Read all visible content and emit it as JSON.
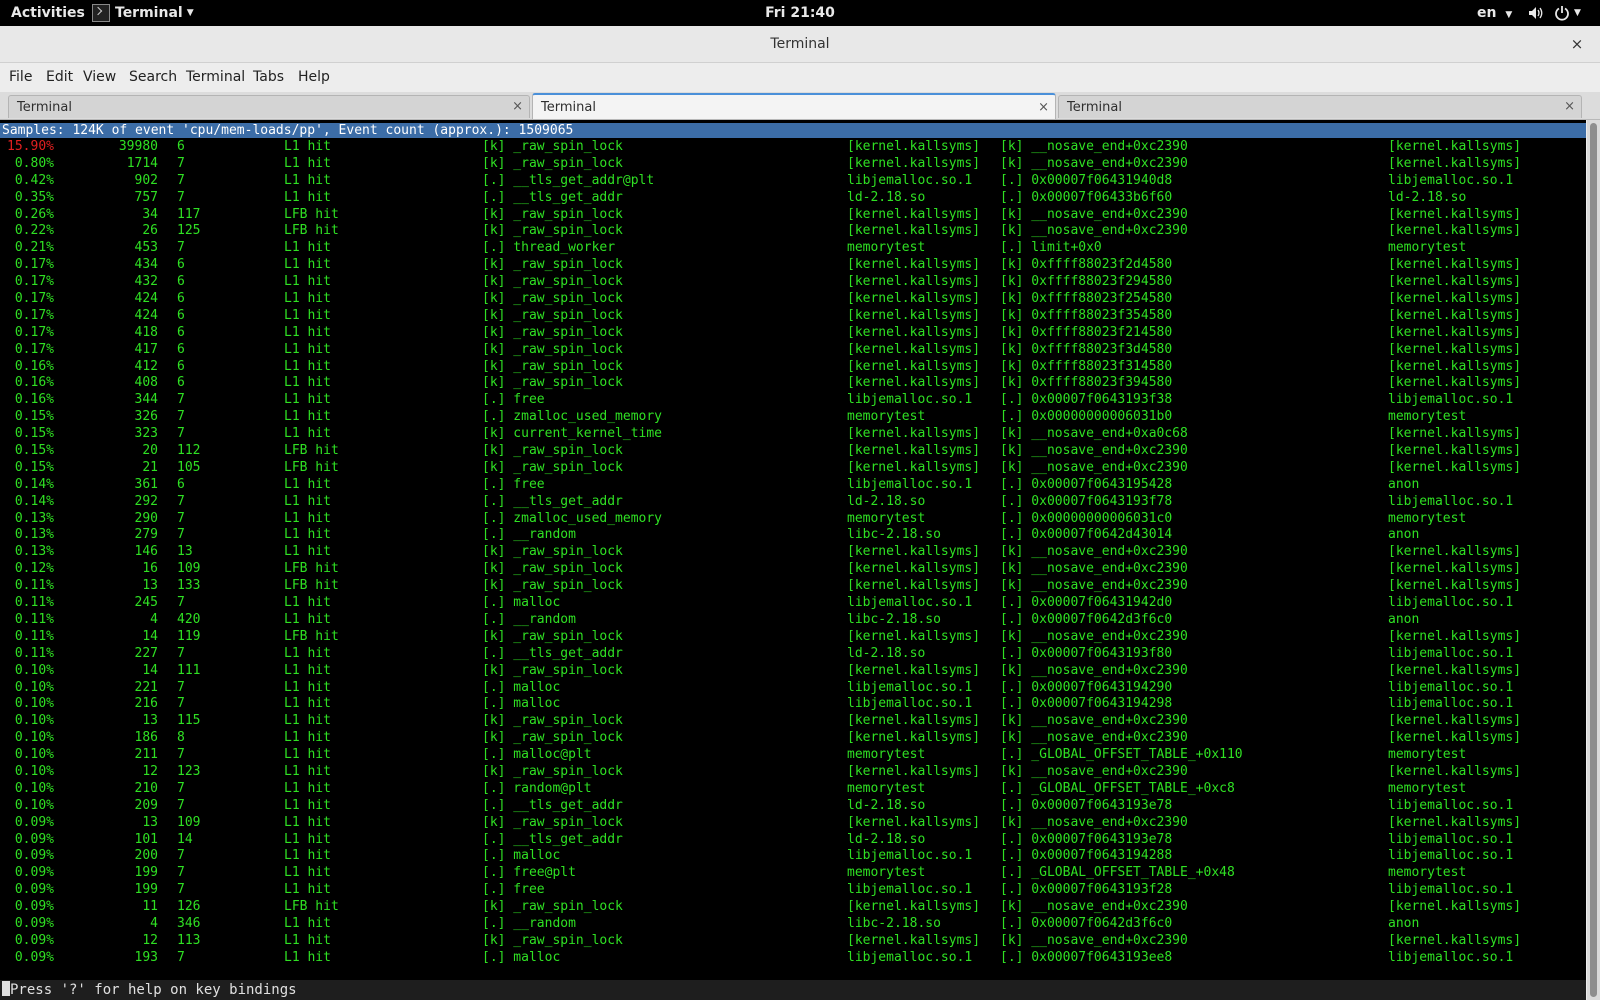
{
  "topbar": {
    "activities": "Activities",
    "app_menu": "Terminal",
    "clock": "Fri 21:40",
    "language": "en"
  },
  "window": {
    "title": "Terminal",
    "close_label": "×"
  },
  "menubar": [
    "File",
    "Edit",
    "View",
    "Search",
    "Terminal",
    "Tabs",
    "Help"
  ],
  "tabs": [
    {
      "label": "Terminal",
      "close": "×"
    },
    {
      "label": "Terminal",
      "close": "×"
    },
    {
      "label": "Terminal",
      "close": "×"
    }
  ],
  "perf": {
    "header": "Samples: 124K of event 'cpu/mem-loads/pp', Event count (approx.): 1509065",
    "rows": [
      {
        "pct": "15.90%",
        "samples": "39980",
        "weight": "6",
        "type": "L1 hit",
        "sym": "[k] _raw_spin_lock",
        "obj": "[kernel.kallsyms]",
        "daddr": "[k] __nosave_end+0xc2390",
        "dobj": "[kernel.kallsyms]"
      },
      {
        "pct": "0.80%",
        "samples": "1714",
        "weight": "7",
        "type": "L1 hit",
        "sym": "[k] _raw_spin_lock",
        "obj": "[kernel.kallsyms]",
        "daddr": "[k] __nosave_end+0xc2390",
        "dobj": "[kernel.kallsyms]"
      },
      {
        "pct": "0.42%",
        "samples": "902",
        "weight": "7",
        "type": "L1 hit",
        "sym": "[.] __tls_get_addr@plt",
        "obj": "libjemalloc.so.1",
        "daddr": "[.] 0x00007f06431940d8",
        "dobj": "libjemalloc.so.1"
      },
      {
        "pct": "0.35%",
        "samples": "757",
        "weight": "7",
        "type": "L1 hit",
        "sym": "[.] __tls_get_addr",
        "obj": "ld-2.18.so",
        "daddr": "[.] 0x00007f06433b6f60",
        "dobj": "ld-2.18.so"
      },
      {
        "pct": "0.26%",
        "samples": "34",
        "weight": "117",
        "type": "LFB hit",
        "sym": "[k] _raw_spin_lock",
        "obj": "[kernel.kallsyms]",
        "daddr": "[k] __nosave_end+0xc2390",
        "dobj": "[kernel.kallsyms]"
      },
      {
        "pct": "0.22%",
        "samples": "26",
        "weight": "125",
        "type": "LFB hit",
        "sym": "[k] _raw_spin_lock",
        "obj": "[kernel.kallsyms]",
        "daddr": "[k] __nosave_end+0xc2390",
        "dobj": "[kernel.kallsyms]"
      },
      {
        "pct": "0.21%",
        "samples": "453",
        "weight": "7",
        "type": "L1 hit",
        "sym": "[.] thread_worker",
        "obj": "memorytest",
        "daddr": "[.] limit+0x0",
        "dobj": "memorytest"
      },
      {
        "pct": "0.17%",
        "samples": "434",
        "weight": "6",
        "type": "L1 hit",
        "sym": "[k] _raw_spin_lock",
        "obj": "[kernel.kallsyms]",
        "daddr": "[k] 0xffff88023f2d4580",
        "dobj": "[kernel.kallsyms]"
      },
      {
        "pct": "0.17%",
        "samples": "432",
        "weight": "6",
        "type": "L1 hit",
        "sym": "[k] _raw_spin_lock",
        "obj": "[kernel.kallsyms]",
        "daddr": "[k] 0xffff88023f294580",
        "dobj": "[kernel.kallsyms]"
      },
      {
        "pct": "0.17%",
        "samples": "424",
        "weight": "6",
        "type": "L1 hit",
        "sym": "[k] _raw_spin_lock",
        "obj": "[kernel.kallsyms]",
        "daddr": "[k] 0xffff88023f254580",
        "dobj": "[kernel.kallsyms]"
      },
      {
        "pct": "0.17%",
        "samples": "424",
        "weight": "6",
        "type": "L1 hit",
        "sym": "[k] _raw_spin_lock",
        "obj": "[kernel.kallsyms]",
        "daddr": "[k] 0xffff88023f354580",
        "dobj": "[kernel.kallsyms]"
      },
      {
        "pct": "0.17%",
        "samples": "418",
        "weight": "6",
        "type": "L1 hit",
        "sym": "[k] _raw_spin_lock",
        "obj": "[kernel.kallsyms]",
        "daddr": "[k] 0xffff88023f214580",
        "dobj": "[kernel.kallsyms]"
      },
      {
        "pct": "0.17%",
        "samples": "417",
        "weight": "6",
        "type": "L1 hit",
        "sym": "[k] _raw_spin_lock",
        "obj": "[kernel.kallsyms]",
        "daddr": "[k] 0xffff88023f3d4580",
        "dobj": "[kernel.kallsyms]"
      },
      {
        "pct": "0.16%",
        "samples": "412",
        "weight": "6",
        "type": "L1 hit",
        "sym": "[k] _raw_spin_lock",
        "obj": "[kernel.kallsyms]",
        "daddr": "[k] 0xffff88023f314580",
        "dobj": "[kernel.kallsyms]"
      },
      {
        "pct": "0.16%",
        "samples": "408",
        "weight": "6",
        "type": "L1 hit",
        "sym": "[k] _raw_spin_lock",
        "obj": "[kernel.kallsyms]",
        "daddr": "[k] 0xffff88023f394580",
        "dobj": "[kernel.kallsyms]"
      },
      {
        "pct": "0.16%",
        "samples": "344",
        "weight": "7",
        "type": "L1 hit",
        "sym": "[.] free",
        "obj": "libjemalloc.so.1",
        "daddr": "[.] 0x00007f0643193f38",
        "dobj": "libjemalloc.so.1"
      },
      {
        "pct": "0.15%",
        "samples": "326",
        "weight": "7",
        "type": "L1 hit",
        "sym": "[.] zmalloc_used_memory",
        "obj": "memorytest",
        "daddr": "[.] 0x00000000006031b0",
        "dobj": "memorytest"
      },
      {
        "pct": "0.15%",
        "samples": "323",
        "weight": "7",
        "type": "L1 hit",
        "sym": "[k] current_kernel_time",
        "obj": "[kernel.kallsyms]",
        "daddr": "[k] __nosave_end+0xa0c68",
        "dobj": "[kernel.kallsyms]"
      },
      {
        "pct": "0.15%",
        "samples": "20",
        "weight": "112",
        "type": "LFB hit",
        "sym": "[k] _raw_spin_lock",
        "obj": "[kernel.kallsyms]",
        "daddr": "[k] __nosave_end+0xc2390",
        "dobj": "[kernel.kallsyms]"
      },
      {
        "pct": "0.15%",
        "samples": "21",
        "weight": "105",
        "type": "LFB hit",
        "sym": "[k] _raw_spin_lock",
        "obj": "[kernel.kallsyms]",
        "daddr": "[k] __nosave_end+0xc2390",
        "dobj": "[kernel.kallsyms]"
      },
      {
        "pct": "0.14%",
        "samples": "361",
        "weight": "6",
        "type": "L1 hit",
        "sym": "[.] free",
        "obj": "libjemalloc.so.1",
        "daddr": "[.] 0x00007f0643195428",
        "dobj": "anon"
      },
      {
        "pct": "0.14%",
        "samples": "292",
        "weight": "7",
        "type": "L1 hit",
        "sym": "[.] __tls_get_addr",
        "obj": "ld-2.18.so",
        "daddr": "[.] 0x00007f0643193f78",
        "dobj": "libjemalloc.so.1"
      },
      {
        "pct": "0.13%",
        "samples": "290",
        "weight": "7",
        "type": "L1 hit",
        "sym": "[.] zmalloc_used_memory",
        "obj": "memorytest",
        "daddr": "[.] 0x00000000006031c0",
        "dobj": "memorytest"
      },
      {
        "pct": "0.13%",
        "samples": "279",
        "weight": "7",
        "type": "L1 hit",
        "sym": "[.] __random",
        "obj": "libc-2.18.so",
        "daddr": "[.] 0x00007f0642d43014",
        "dobj": "anon"
      },
      {
        "pct": "0.13%",
        "samples": "146",
        "weight": "13",
        "type": "L1 hit",
        "sym": "[k] _raw_spin_lock",
        "obj": "[kernel.kallsyms]",
        "daddr": "[k] __nosave_end+0xc2390",
        "dobj": "[kernel.kallsyms]"
      },
      {
        "pct": "0.12%",
        "samples": "16",
        "weight": "109",
        "type": "LFB hit",
        "sym": "[k] _raw_spin_lock",
        "obj": "[kernel.kallsyms]",
        "daddr": "[k] __nosave_end+0xc2390",
        "dobj": "[kernel.kallsyms]"
      },
      {
        "pct": "0.11%",
        "samples": "13",
        "weight": "133",
        "type": "LFB hit",
        "sym": "[k] _raw_spin_lock",
        "obj": "[kernel.kallsyms]",
        "daddr": "[k] __nosave_end+0xc2390",
        "dobj": "[kernel.kallsyms]"
      },
      {
        "pct": "0.11%",
        "samples": "245",
        "weight": "7",
        "type": "L1 hit",
        "sym": "[.] malloc",
        "obj": "libjemalloc.so.1",
        "daddr": "[.] 0x00007f06431942d0",
        "dobj": "libjemalloc.so.1"
      },
      {
        "pct": "0.11%",
        "samples": "4",
        "weight": "420",
        "type": "L1 hit",
        "sym": "[.] __random",
        "obj": "libc-2.18.so",
        "daddr": "[.] 0x00007f0642d3f6c0",
        "dobj": "anon"
      },
      {
        "pct": "0.11%",
        "samples": "14",
        "weight": "119",
        "type": "LFB hit",
        "sym": "[k] _raw_spin_lock",
        "obj": "[kernel.kallsyms]",
        "daddr": "[k] __nosave_end+0xc2390",
        "dobj": "[kernel.kallsyms]"
      },
      {
        "pct": "0.11%",
        "samples": "227",
        "weight": "7",
        "type": "L1 hit",
        "sym": "[.] __tls_get_addr",
        "obj": "ld-2.18.so",
        "daddr": "[.] 0x00007f0643193f80",
        "dobj": "libjemalloc.so.1"
      },
      {
        "pct": "0.10%",
        "samples": "14",
        "weight": "111",
        "type": "L1 hit",
        "sym": "[k] _raw_spin_lock",
        "obj": "[kernel.kallsyms]",
        "daddr": "[k] __nosave_end+0xc2390",
        "dobj": "[kernel.kallsyms]"
      },
      {
        "pct": "0.10%",
        "samples": "221",
        "weight": "7",
        "type": "L1 hit",
        "sym": "[.] malloc",
        "obj": "libjemalloc.so.1",
        "daddr": "[.] 0x00007f0643194290",
        "dobj": "libjemalloc.so.1"
      },
      {
        "pct": "0.10%",
        "samples": "216",
        "weight": "7",
        "type": "L1 hit",
        "sym": "[.] malloc",
        "obj": "libjemalloc.so.1",
        "daddr": "[.] 0x00007f0643194298",
        "dobj": "libjemalloc.so.1"
      },
      {
        "pct": "0.10%",
        "samples": "13",
        "weight": "115",
        "type": "L1 hit",
        "sym": "[k] _raw_spin_lock",
        "obj": "[kernel.kallsyms]",
        "daddr": "[k] __nosave_end+0xc2390",
        "dobj": "[kernel.kallsyms]"
      },
      {
        "pct": "0.10%",
        "samples": "186",
        "weight": "8",
        "type": "L1 hit",
        "sym": "[k] _raw_spin_lock",
        "obj": "[kernel.kallsyms]",
        "daddr": "[k] __nosave_end+0xc2390",
        "dobj": "[kernel.kallsyms]"
      },
      {
        "pct": "0.10%",
        "samples": "211",
        "weight": "7",
        "type": "L1 hit",
        "sym": "[.] malloc@plt",
        "obj": "memorytest",
        "daddr": "[.] _GLOBAL_OFFSET_TABLE_+0x110",
        "dobj": "memorytest"
      },
      {
        "pct": "0.10%",
        "samples": "12",
        "weight": "123",
        "type": "L1 hit",
        "sym": "[k] _raw_spin_lock",
        "obj": "[kernel.kallsyms]",
        "daddr": "[k] __nosave_end+0xc2390",
        "dobj": "[kernel.kallsyms]"
      },
      {
        "pct": "0.10%",
        "samples": "210",
        "weight": "7",
        "type": "L1 hit",
        "sym": "[.] random@plt",
        "obj": "memorytest",
        "daddr": "[.] _GLOBAL_OFFSET_TABLE_+0xc8",
        "dobj": "memorytest"
      },
      {
        "pct": "0.10%",
        "samples": "209",
        "weight": "7",
        "type": "L1 hit",
        "sym": "[.] __tls_get_addr",
        "obj": "ld-2.18.so",
        "daddr": "[.] 0x00007f0643193e78",
        "dobj": "libjemalloc.so.1"
      },
      {
        "pct": "0.09%",
        "samples": "13",
        "weight": "109",
        "type": "L1 hit",
        "sym": "[k] _raw_spin_lock",
        "obj": "[kernel.kallsyms]",
        "daddr": "[k] __nosave_end+0xc2390",
        "dobj": "[kernel.kallsyms]"
      },
      {
        "pct": "0.09%",
        "samples": "101",
        "weight": "14",
        "type": "L1 hit",
        "sym": "[.] __tls_get_addr",
        "obj": "ld-2.18.so",
        "daddr": "[.] 0x00007f0643193e78",
        "dobj": "libjemalloc.so.1"
      },
      {
        "pct": "0.09%",
        "samples": "200",
        "weight": "7",
        "type": "L1 hit",
        "sym": "[.] malloc",
        "obj": "libjemalloc.so.1",
        "daddr": "[.] 0x00007f0643194288",
        "dobj": "libjemalloc.so.1"
      },
      {
        "pct": "0.09%",
        "samples": "199",
        "weight": "7",
        "type": "L1 hit",
        "sym": "[.] free@plt",
        "obj": "memorytest",
        "daddr": "[.] _GLOBAL_OFFSET_TABLE_+0x48",
        "dobj": "memorytest"
      },
      {
        "pct": "0.09%",
        "samples": "199",
        "weight": "7",
        "type": "L1 hit",
        "sym": "[.] free",
        "obj": "libjemalloc.so.1",
        "daddr": "[.] 0x00007f0643193f28",
        "dobj": "libjemalloc.so.1"
      },
      {
        "pct": "0.09%",
        "samples": "11",
        "weight": "126",
        "type": "LFB hit",
        "sym": "[k] _raw_spin_lock",
        "obj": "[kernel.kallsyms]",
        "daddr": "[k] __nosave_end+0xc2390",
        "dobj": "[kernel.kallsyms]"
      },
      {
        "pct": "0.09%",
        "samples": "4",
        "weight": "346",
        "type": "L1 hit",
        "sym": "[.] __random",
        "obj": "libc-2.18.so",
        "daddr": "[.] 0x00007f0642d3f6c0",
        "dobj": "anon"
      },
      {
        "pct": "0.09%",
        "samples": "12",
        "weight": "113",
        "type": "L1 hit",
        "sym": "[k] _raw_spin_lock",
        "obj": "[kernel.kallsyms]",
        "daddr": "[k] __nosave_end+0xc2390",
        "dobj": "[kernel.kallsyms]"
      },
      {
        "pct": "0.09%",
        "samples": "193",
        "weight": "7",
        "type": "L1 hit",
        "sym": "[.] malloc",
        "obj": "libjemalloc.so.1",
        "daddr": "[.] 0x00007f0643193ee8",
        "dobj": "libjemalloc.so.1"
      }
    ],
    "status": "Press '?' for help on key bindings"
  },
  "colors": {
    "terminal_fg": "#2fe023",
    "terminal_bg": "#000000",
    "top_row_pct": "#e02020",
    "header_bg": "#3c6da7",
    "active_tab_accent": "#4a90d9"
  }
}
